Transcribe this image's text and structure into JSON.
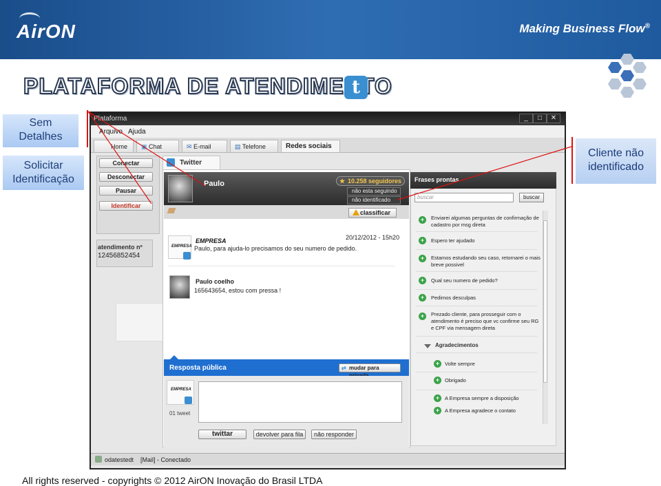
{
  "header": {
    "logo": "AirON",
    "tagline": "Making Business Flow",
    "tagline_mark": "®"
  },
  "title": "PLATAFORMA DE ATENDIMENTO",
  "callouts": {
    "sem_detalhes": "Sem Detalhes",
    "solicitar": "Solicitar Identificação",
    "cliente": "Cliente não identificado"
  },
  "window": {
    "title": "Plataforma",
    "menu": [
      "Arquivo",
      "Ajuda"
    ],
    "nav_tabs": [
      "Home",
      "Chat",
      "E-mail",
      "Telefone",
      "Redes sociais"
    ],
    "controls": {
      "conectar": "Conectar",
      "desconectar": "Desconectar",
      "pausar": "Pausar",
      "identificar": "Identificar"
    },
    "atendimento": {
      "label": "atendimento nº",
      "number": "12456852454"
    },
    "content_tab": "Twitter",
    "profile": {
      "name": "Paulo",
      "followers": "10.258 seguidores",
      "not_following": "não esta seguindo",
      "not_identified": "não identificado",
      "classify": "classificar"
    },
    "messages": [
      {
        "thumb": "EMPRESA",
        "author": "EMPRESA",
        "date": "20/12/2012  -  15h20",
        "text": "Paulo, para ajuda-lo precisamos do seu numero de pedido."
      },
      {
        "author": "Paulo coelho",
        "text": "165643654, estou com pressa !"
      }
    ],
    "reply": {
      "title": "Resposta pública",
      "private_button": "mudar para privada",
      "thumb": "EMPRESA",
      "count": "01 tweet",
      "tweet_button": "twittar",
      "return_button": "devolver para fila",
      "no_reply_button": "não responder"
    },
    "quick": {
      "title": "Frases prontas",
      "search_placeholder": "buscar",
      "search_button": "buscar",
      "items": [
        "Enviarei algumas perguntas de confirmação de cadastro por msg direta",
        "Espero ter ajudado",
        "Estamos estudando seu caso, retornarei o mais breve possivel",
        "Qual seu numero de pedido?",
        "Pedimos desculpas",
        "Prezado cliente, para prosseguir com o atendimento é preciso que vc confirme seu RG e CPF via mensagem direta"
      ],
      "group": "Agradecimentos",
      "group_items": [
        "Volte sempre",
        "Obrigado",
        "A Empresa sempre a disposição",
        "A Empresa agradece o contato"
      ]
    },
    "status": {
      "user": "odatestedt",
      "mail": "[Mail] - Conectado"
    }
  },
  "footer": "All rights reserved - copyrights © 2012 AirON Inovação do Brasil LTDA",
  "colors": {
    "banner": "#2f6db3",
    "accent_blue": "#1f6fd1",
    "alert_red": "#d11111",
    "plus_green": "#3aa348"
  }
}
